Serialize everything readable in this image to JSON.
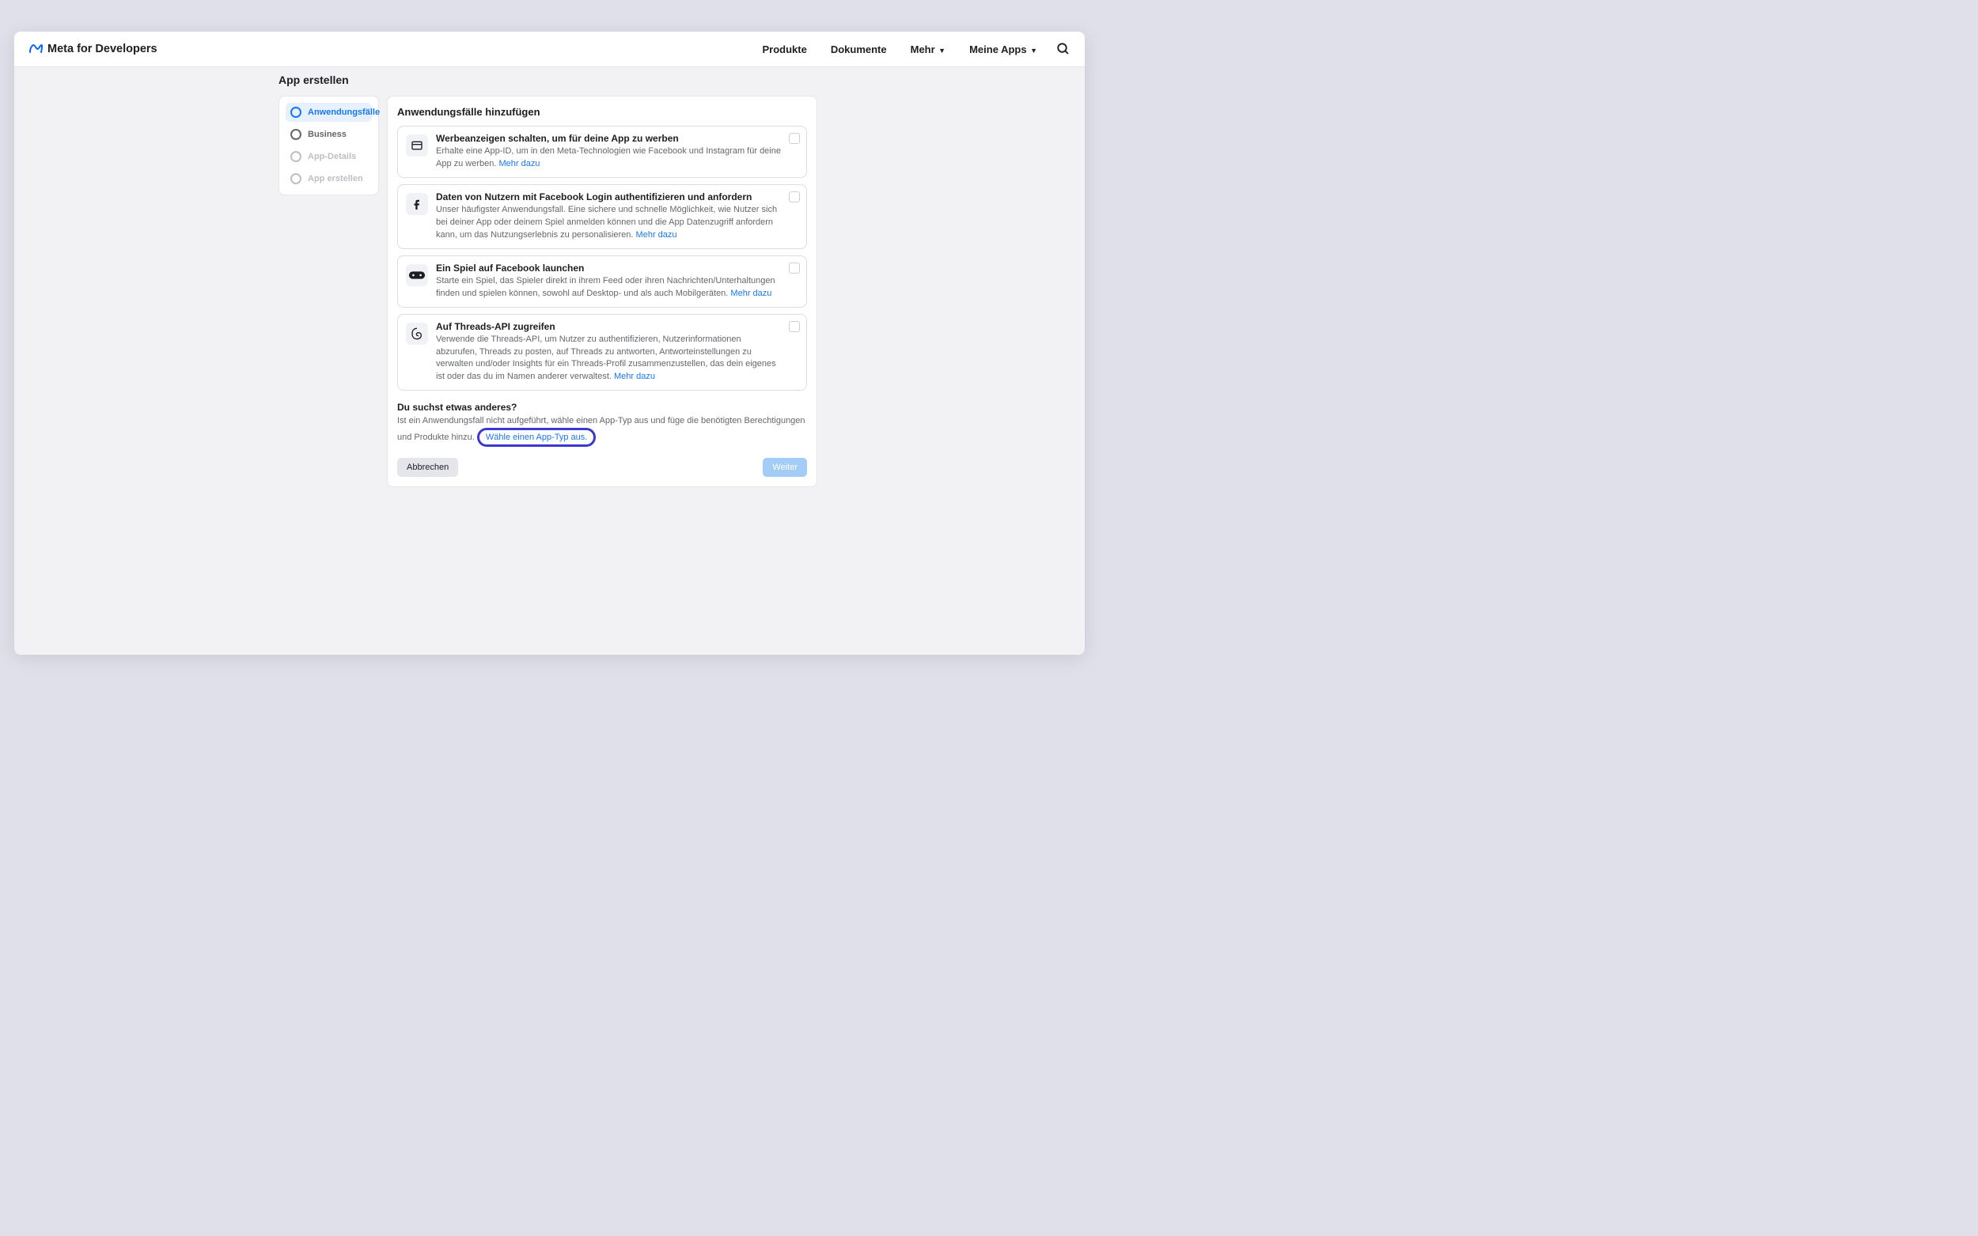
{
  "brand": {
    "text": "Meta for Developers"
  },
  "nav": {
    "products": "Produkte",
    "docs": "Dokumente",
    "more": "Mehr",
    "myapps": "Meine Apps"
  },
  "page": {
    "title": "App erstellen"
  },
  "steps": [
    {
      "label": "Anwendungsfälle",
      "state": "active"
    },
    {
      "label": "Business",
      "state": "default"
    },
    {
      "label": "App-Details",
      "state": "muted"
    },
    {
      "label": "App erstellen",
      "state": "muted"
    }
  ],
  "panel": {
    "heading": "Anwendungsfälle hinzufügen",
    "cards": [
      {
        "icon": "ad-icon",
        "title": "Werbeanzeigen schalten, um für deine App zu werben",
        "desc": "Erhalte eine App-ID, um in den Meta-Technologien wie Facebook und Instagram für deine App zu werben.",
        "more": "Mehr dazu"
      },
      {
        "icon": "facebook-icon",
        "title": "Daten von Nutzern mit Facebook Login authentifizieren und anfordern",
        "desc": "Unser häufigster Anwendungsfall. Eine sichere und schnelle Möglichkeit, wie Nutzer sich bei deiner App oder deinem Spiel anmelden können und die App Datenzugriff anfordern kann, um das Nutzungserlebnis zu personalisieren.",
        "more": "Mehr dazu"
      },
      {
        "icon": "game-icon",
        "title": "Ein Spiel auf Facebook launchen",
        "desc": "Starte ein Spiel, das Spieler direkt in ihrem Feed oder ihren Nachrichten/Unterhaltungen finden und spielen können, sowohl auf Desktop- und als auch Mobilgeräten.",
        "more": "Mehr dazu"
      },
      {
        "icon": "threads-icon",
        "title": "Auf Threads-API zugreifen",
        "desc": "Verwende die Threads-API, um Nutzer zu authentifizieren, Nutzerinformationen abzurufen, Threads zu posten, auf Threads zu antworten, Antworteinstellungen zu verwalten und/oder Insights für ein Threads-Profil zusammenzustellen, das dein eigenes ist oder das du im Namen anderer verwaltest.",
        "more": "Mehr dazu"
      }
    ],
    "alt": {
      "heading": "Du suchst etwas anderes?",
      "desc_pre": "Ist ein Anwendungsfall nicht aufgeführt, wähle einen App-Typ aus und füge die benötigten Berechtigungen und Produkte hinzu.",
      "link": "Wähle einen App-Typ aus."
    },
    "actions": {
      "cancel": "Abbrechen",
      "next": "Weiter"
    }
  }
}
